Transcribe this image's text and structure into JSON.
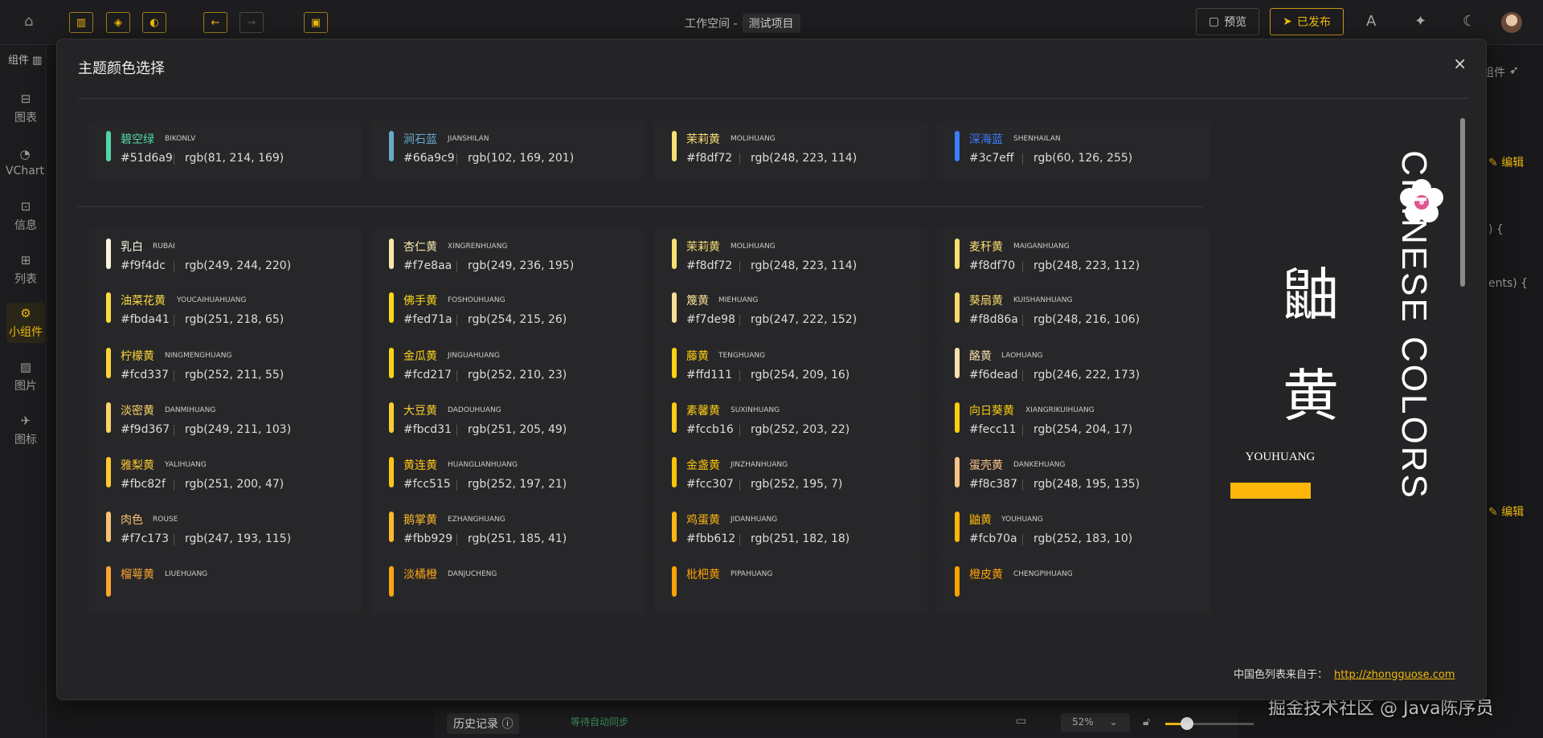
{
  "topbar": {
    "workspace": "工作空间 -",
    "project": "测试项目",
    "preview_label": "预览",
    "publish_label": "已发布"
  },
  "sidebar": {
    "header": "组件",
    "items": [
      {
        "label": "图表",
        "icon": "chart-icon"
      },
      {
        "label": "VChart",
        "icon": "vchart-icon"
      },
      {
        "label": "信息",
        "icon": "info-icon"
      },
      {
        "label": "列表",
        "icon": "table-icon"
      },
      {
        "label": "小组件",
        "icon": "widget-icon",
        "active": true
      },
      {
        "label": "图片",
        "icon": "image-icon"
      },
      {
        "label": "图标",
        "icon": "icon-icon"
      }
    ]
  },
  "background_right": {
    "label_component": "组件",
    "edit_label": "编辑",
    "code_fragment_1": ") {",
    "code_fragment_2": "ents) {"
  },
  "bottombar": {
    "history_label": "历史记录",
    "autosave_text": "等待自动同步",
    "zoom_value": "52%"
  },
  "watermark": "掘金技术社区 @ Java陈序员",
  "modal": {
    "title": "主题颜色选择",
    "close": "×",
    "recent_colors": [
      {
        "name": "碧空绿",
        "pinyin": "BIKONLV",
        "hex": "#51d6a9",
        "rgb": "rgb(81, 214, 169)",
        "color": "#51d6a9"
      },
      {
        "name": "涧石蓝",
        "pinyin": "JIANSHILAN",
        "hex": "#66a9c9",
        "rgb": "rgb(102, 169, 201)",
        "color": "#66a9c9"
      },
      {
        "name": "茉莉黄",
        "pinyin": "MOLIHUANG",
        "hex": "#f8df72",
        "rgb": "rgb(248, 223, 114)",
        "color": "#f8df72"
      },
      {
        "name": "深海蓝",
        "pinyin": "SHENHAILAN",
        "hex": "#3c7eff",
        "rgb": "rgb(60, 126, 255)",
        "color": "#3c7eff"
      }
    ],
    "colors": [
      {
        "name": "乳白",
        "pinyin": "RUBAI",
        "hex": "#f9f4dc",
        "rgb": "rgb(249, 244, 220)",
        "color": "#f9f4dc"
      },
      {
        "name": "杏仁黄",
        "pinyin": "XINGRENHUANG",
        "hex": "#f7e8aa",
        "rgb": "rgb(249, 236, 195)",
        "color": "#f7e8aa"
      },
      {
        "name": "茉莉黄",
        "pinyin": "MOLIHUANG",
        "hex": "#f8df72",
        "rgb": "rgb(248, 223, 114)",
        "color": "#f8df72"
      },
      {
        "name": "麦秆黄",
        "pinyin": "MAIGANHUANG",
        "hex": "#f8df70",
        "rgb": "rgb(248, 223, 112)",
        "color": "#f8df70"
      },
      {
        "name": "油菜花黄",
        "pinyin": "YOUCAIHUAHUANG",
        "hex": "#fbda41",
        "rgb": "rgb(251, 218, 65)",
        "color": "#fbda41"
      },
      {
        "name": "佛手黄",
        "pinyin": "FOSHOUHUANG",
        "hex": "#fed71a",
        "rgb": "rgb(254, 215, 26)",
        "color": "#fed71a"
      },
      {
        "name": "篾黄",
        "pinyin": "MIEHUANG",
        "hex": "#f7de98",
        "rgb": "rgb(247, 222, 152)",
        "color": "#f7de98"
      },
      {
        "name": "葵扇黄",
        "pinyin": "KUISHANHUANG",
        "hex": "#f8d86a",
        "rgb": "rgb(248, 216, 106)",
        "color": "#f8d86a"
      },
      {
        "name": "柠檬黄",
        "pinyin": "NINGMENGHUANG",
        "hex": "#fcd337",
        "rgb": "rgb(252, 211, 55)",
        "color": "#fcd337"
      },
      {
        "name": "金瓜黄",
        "pinyin": "JINGUAHUANG",
        "hex": "#fcd217",
        "rgb": "rgb(252, 210, 23)",
        "color": "#fcd217"
      },
      {
        "name": "藤黄",
        "pinyin": "TENGHUANG",
        "hex": "#ffd111",
        "rgb": "rgb(254, 209, 16)",
        "color": "#ffd111"
      },
      {
        "name": "酪黄",
        "pinyin": "LAOHUANG",
        "hex": "#f6dead",
        "rgb": "rgb(246, 222, 173)",
        "color": "#f6dead"
      },
      {
        "name": "淡密黄",
        "pinyin": "DANMIHUANG",
        "hex": "#f9d367",
        "rgb": "rgb(249, 211, 103)",
        "color": "#f9d367"
      },
      {
        "name": "大豆黄",
        "pinyin": "DADOUHUANG",
        "hex": "#fbcd31",
        "rgb": "rgb(251, 205, 49)",
        "color": "#fbcd31"
      },
      {
        "name": "素馨黄",
        "pinyin": "SUXINHUANG",
        "hex": "#fccb16",
        "rgb": "rgb(252, 203, 22)",
        "color": "#fccb16"
      },
      {
        "name": "向日葵黄",
        "pinyin": "XIANGRIKUIHUANG",
        "hex": "#fecc11",
        "rgb": "rgb(254, 204, 17)",
        "color": "#fecc11"
      },
      {
        "name": "雅梨黄",
        "pinyin": "YALIHUANG",
        "hex": "#fbc82f",
        "rgb": "rgb(251, 200, 47)",
        "color": "#fbc82f"
      },
      {
        "name": "黄连黄",
        "pinyin": "HUANGLIANHUANG",
        "hex": "#fcc515",
        "rgb": "rgb(252, 197, 21)",
        "color": "#fcc515"
      },
      {
        "name": "金盏黄",
        "pinyin": "JINZHANHUANG",
        "hex": "#fcc307",
        "rgb": "rgb(252, 195, 7)",
        "color": "#fcc307"
      },
      {
        "name": "蛋壳黄",
        "pinyin": "DANKEHUANG",
        "hex": "#f8c387",
        "rgb": "rgb(248, 195, 135)",
        "color": "#f8c387"
      },
      {
        "name": "肉色",
        "pinyin": "ROUSE",
        "hex": "#f7c173",
        "rgb": "rgb(247, 193, 115)",
        "color": "#f7c173"
      },
      {
        "name": "鹅掌黄",
        "pinyin": "EZHANGHUANG",
        "hex": "#fbb929",
        "rgb": "rgb(251, 185, 41)",
        "color": "#fbb929"
      },
      {
        "name": "鸡蛋黄",
        "pinyin": "JIDANHUANG",
        "hex": "#fbb612",
        "rgb": "rgb(251, 182, 18)",
        "color": "#fbb612"
      },
      {
        "name": "鼬黄",
        "pinyin": "YOUHUANG",
        "hex": "#fcb70a",
        "rgb": "rgb(252, 183, 10)",
        "color": "#fcb70a"
      },
      {
        "name": "榴萼黄",
        "pinyin": "LIUEHUANG",
        "hex": "",
        "rgb": "",
        "color": "#f9a633"
      },
      {
        "name": "淡橘橙",
        "pinyin": "DANJUCHENG",
        "hex": "",
        "rgb": "",
        "color": "#fba414"
      },
      {
        "name": "枇杷黄",
        "pinyin": "PIPAHUANG",
        "hex": "",
        "rgb": "",
        "color": "#fca106"
      },
      {
        "name": "橙皮黄",
        "pinyin": "CHENGPIHUANG",
        "hex": "",
        "rgb": "",
        "color": "#fca104"
      }
    ],
    "feature": {
      "char1": "鼬",
      "char2": "黄",
      "pinyin": "YOUHUANG",
      "swatch_color": "#fcb70a",
      "brand": "CHINESE COLORS"
    },
    "source_label": "中国色列表来自于：",
    "source_link": "http://zhongguose.com"
  }
}
